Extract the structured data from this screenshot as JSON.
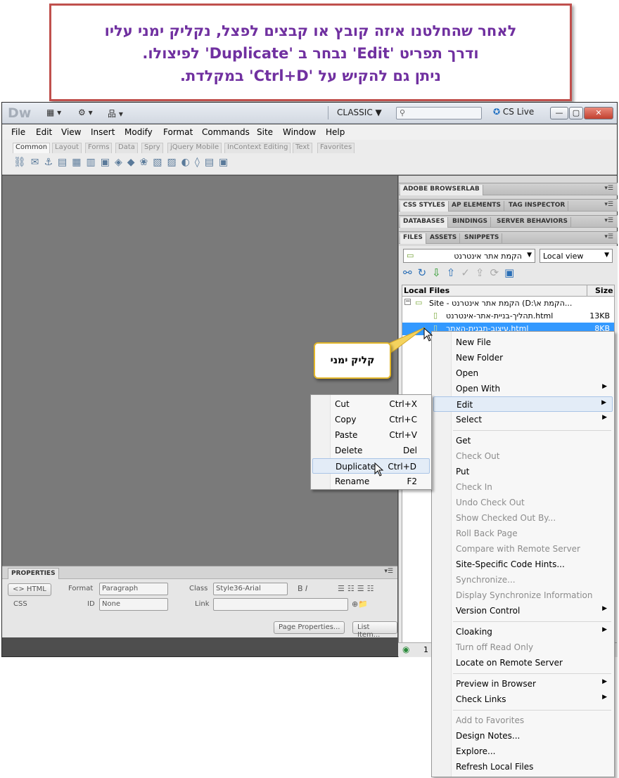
{
  "callout": {
    "line1": "לאחר שהחלטנו איזה קובץ או קבצים לפצל, נקליק ימני עליו",
    "line2": "ודרך תפריט 'Edit' נבחר ב 'Duplicate' לפיצולו.",
    "line3": "ניתן גם להקיש על 'Ctrl+D' במקלדת."
  },
  "titlebar": {
    "logo": "Dw",
    "workspace": "CLASSIC ▼",
    "cs_live": "CS Live",
    "min": "—",
    "max": "▢",
    "close": "✕"
  },
  "menubar": [
    "File",
    "Edit",
    "View",
    "Insert",
    "Modify",
    "Format",
    "Commands",
    "Site",
    "Window",
    "Help"
  ],
  "insert_tabs": [
    "Common",
    "Layout",
    "Forms",
    "Data",
    "Spry",
    "jQuery Mobile",
    "InContext Editing",
    "Text",
    "Favorites"
  ],
  "properties": {
    "title": "PROPERTIES",
    "html": "<> HTML",
    "css": "CSS",
    "format_label": "Format",
    "format_value": "Paragraph",
    "class_label": "Class",
    "class_value": "Style36-Arial",
    "id_label": "ID",
    "id_value": "None",
    "link_label": "Link",
    "page_properties": "Page Properties...",
    "list_item": "List Item..."
  },
  "panels": {
    "browserlab": "ADOBE BROWSERLAB",
    "css_tabs": [
      "CSS STYLES",
      "AP ELEMENTS",
      "TAG INSPECTOR"
    ],
    "db_tabs": [
      "DATABASES",
      "BINDINGS",
      "SERVER BEHAVIORS"
    ],
    "files_tabs": [
      "FILES",
      "ASSETS",
      "SNIPPETS"
    ],
    "site_select": "הקמת אתר אינטרנט",
    "view_select": "Local view",
    "col_local": "Local Files",
    "col_size": "Size",
    "site_row": "Site - הקמת אתר אינטרנט (D:\\הקמת א...",
    "files": [
      {
        "name": "תהליך-בניית-אתר-אינטרנט.html",
        "size": "13KB"
      },
      {
        "name": "עיצוב-תבנית-האתר.html",
        "size": "8KB"
      }
    ],
    "status_num": "1"
  },
  "balloon": "קליק ימני",
  "context_menu": {
    "items": [
      {
        "label": "New File",
        "dis": false
      },
      {
        "label": "New Folder",
        "dis": false
      },
      {
        "label": "Open",
        "dis": false
      },
      {
        "label": "Open With",
        "dis": false,
        "sub": true
      },
      {
        "label": "Edit",
        "dis": false,
        "sub": true
      },
      {
        "label": "Select",
        "dis": false,
        "sub": true
      },
      {
        "label": "Get",
        "dis": false
      },
      {
        "label": "Check Out",
        "dis": true
      },
      {
        "label": "Put",
        "dis": false
      },
      {
        "label": "Check In",
        "dis": true
      },
      {
        "label": "Undo Check Out",
        "dis": true
      },
      {
        "label": "Show Checked Out By...",
        "dis": true
      },
      {
        "label": "Roll Back Page",
        "dis": true
      },
      {
        "label": "Compare with Remote Server",
        "dis": true
      },
      {
        "label": "Site-Specific Code Hints...",
        "dis": false
      },
      {
        "label": "Synchronize...",
        "dis": true
      },
      {
        "label": "Display Synchronize Information",
        "dis": true
      },
      {
        "label": "Version Control",
        "dis": false,
        "sub": true
      },
      {
        "label": "Cloaking",
        "dis": false,
        "sub": true
      },
      {
        "label": "Turn off Read Only",
        "dis": true
      },
      {
        "label": "Locate on Remote Server",
        "dis": false
      },
      {
        "label": "Preview in Browser",
        "dis": false,
        "sub": true
      },
      {
        "label": "Check Links",
        "dis": false,
        "sub": true
      },
      {
        "label": "Add to Favorites",
        "dis": true
      },
      {
        "label": "Design Notes...",
        "dis": false
      },
      {
        "label": "Explore...",
        "dis": false
      },
      {
        "label": "Refresh Local Files",
        "dis": false
      }
    ]
  },
  "edit_submenu": [
    {
      "label": "Cut",
      "shortcut": "Ctrl+X"
    },
    {
      "label": "Copy",
      "shortcut": "Ctrl+C"
    },
    {
      "label": "Paste",
      "shortcut": "Ctrl+V"
    },
    {
      "label": "Delete",
      "shortcut": "Del"
    },
    {
      "label": "Duplicate",
      "shortcut": "Ctrl+D"
    },
    {
      "label": "Rename",
      "shortcut": "F2"
    }
  ]
}
